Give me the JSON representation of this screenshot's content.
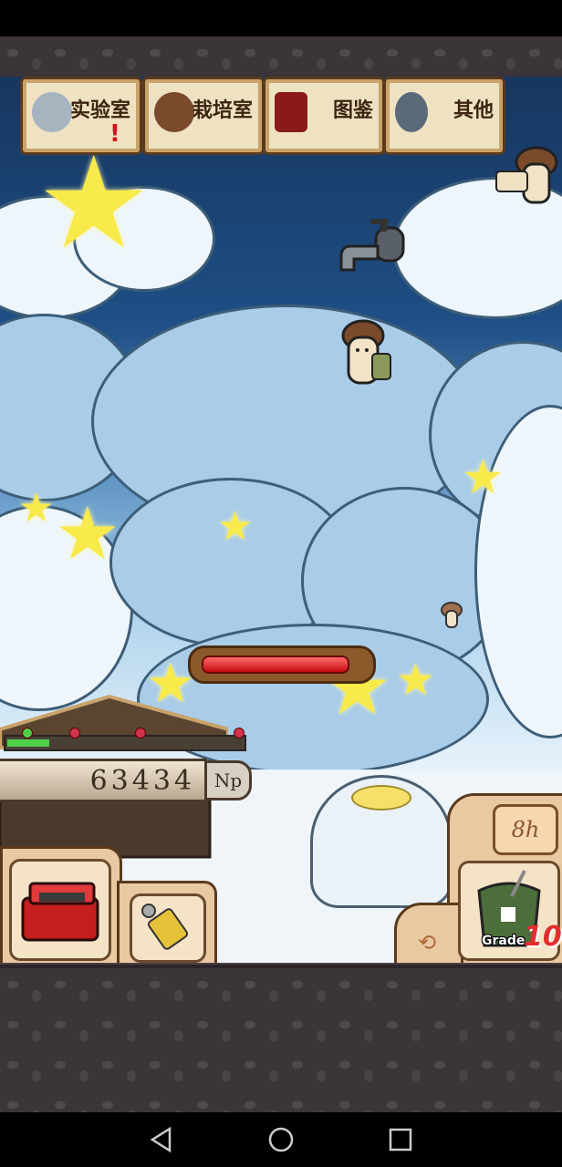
{
  "menu": {
    "lab": "实验室",
    "cultivation": "栽培室",
    "encyclopedia": "图鉴",
    "other": "其他",
    "lab_alert": "!"
  },
  "stats": {
    "np_value": "63434",
    "np_unit": "Np",
    "hp_fill": 0.92,
    "growth_progress": 0.18
  },
  "timer": {
    "value": "8h"
  },
  "grade": {
    "label": "Grade",
    "value": "10"
  },
  "colors": {
    "sky_dark": "#17365f",
    "cloud": "#d4e8f6",
    "star": "#f7ea4a",
    "hp_red": "#c40c0c",
    "panel": "#e9c9a2"
  },
  "icons": [
    "lab-mushroom-icon",
    "cultivation-log-icon",
    "book-icon",
    "magnifier-icon",
    "toolbox-icon",
    "spray-icon",
    "fertilizer-bag-icon",
    "swap-icon"
  ]
}
